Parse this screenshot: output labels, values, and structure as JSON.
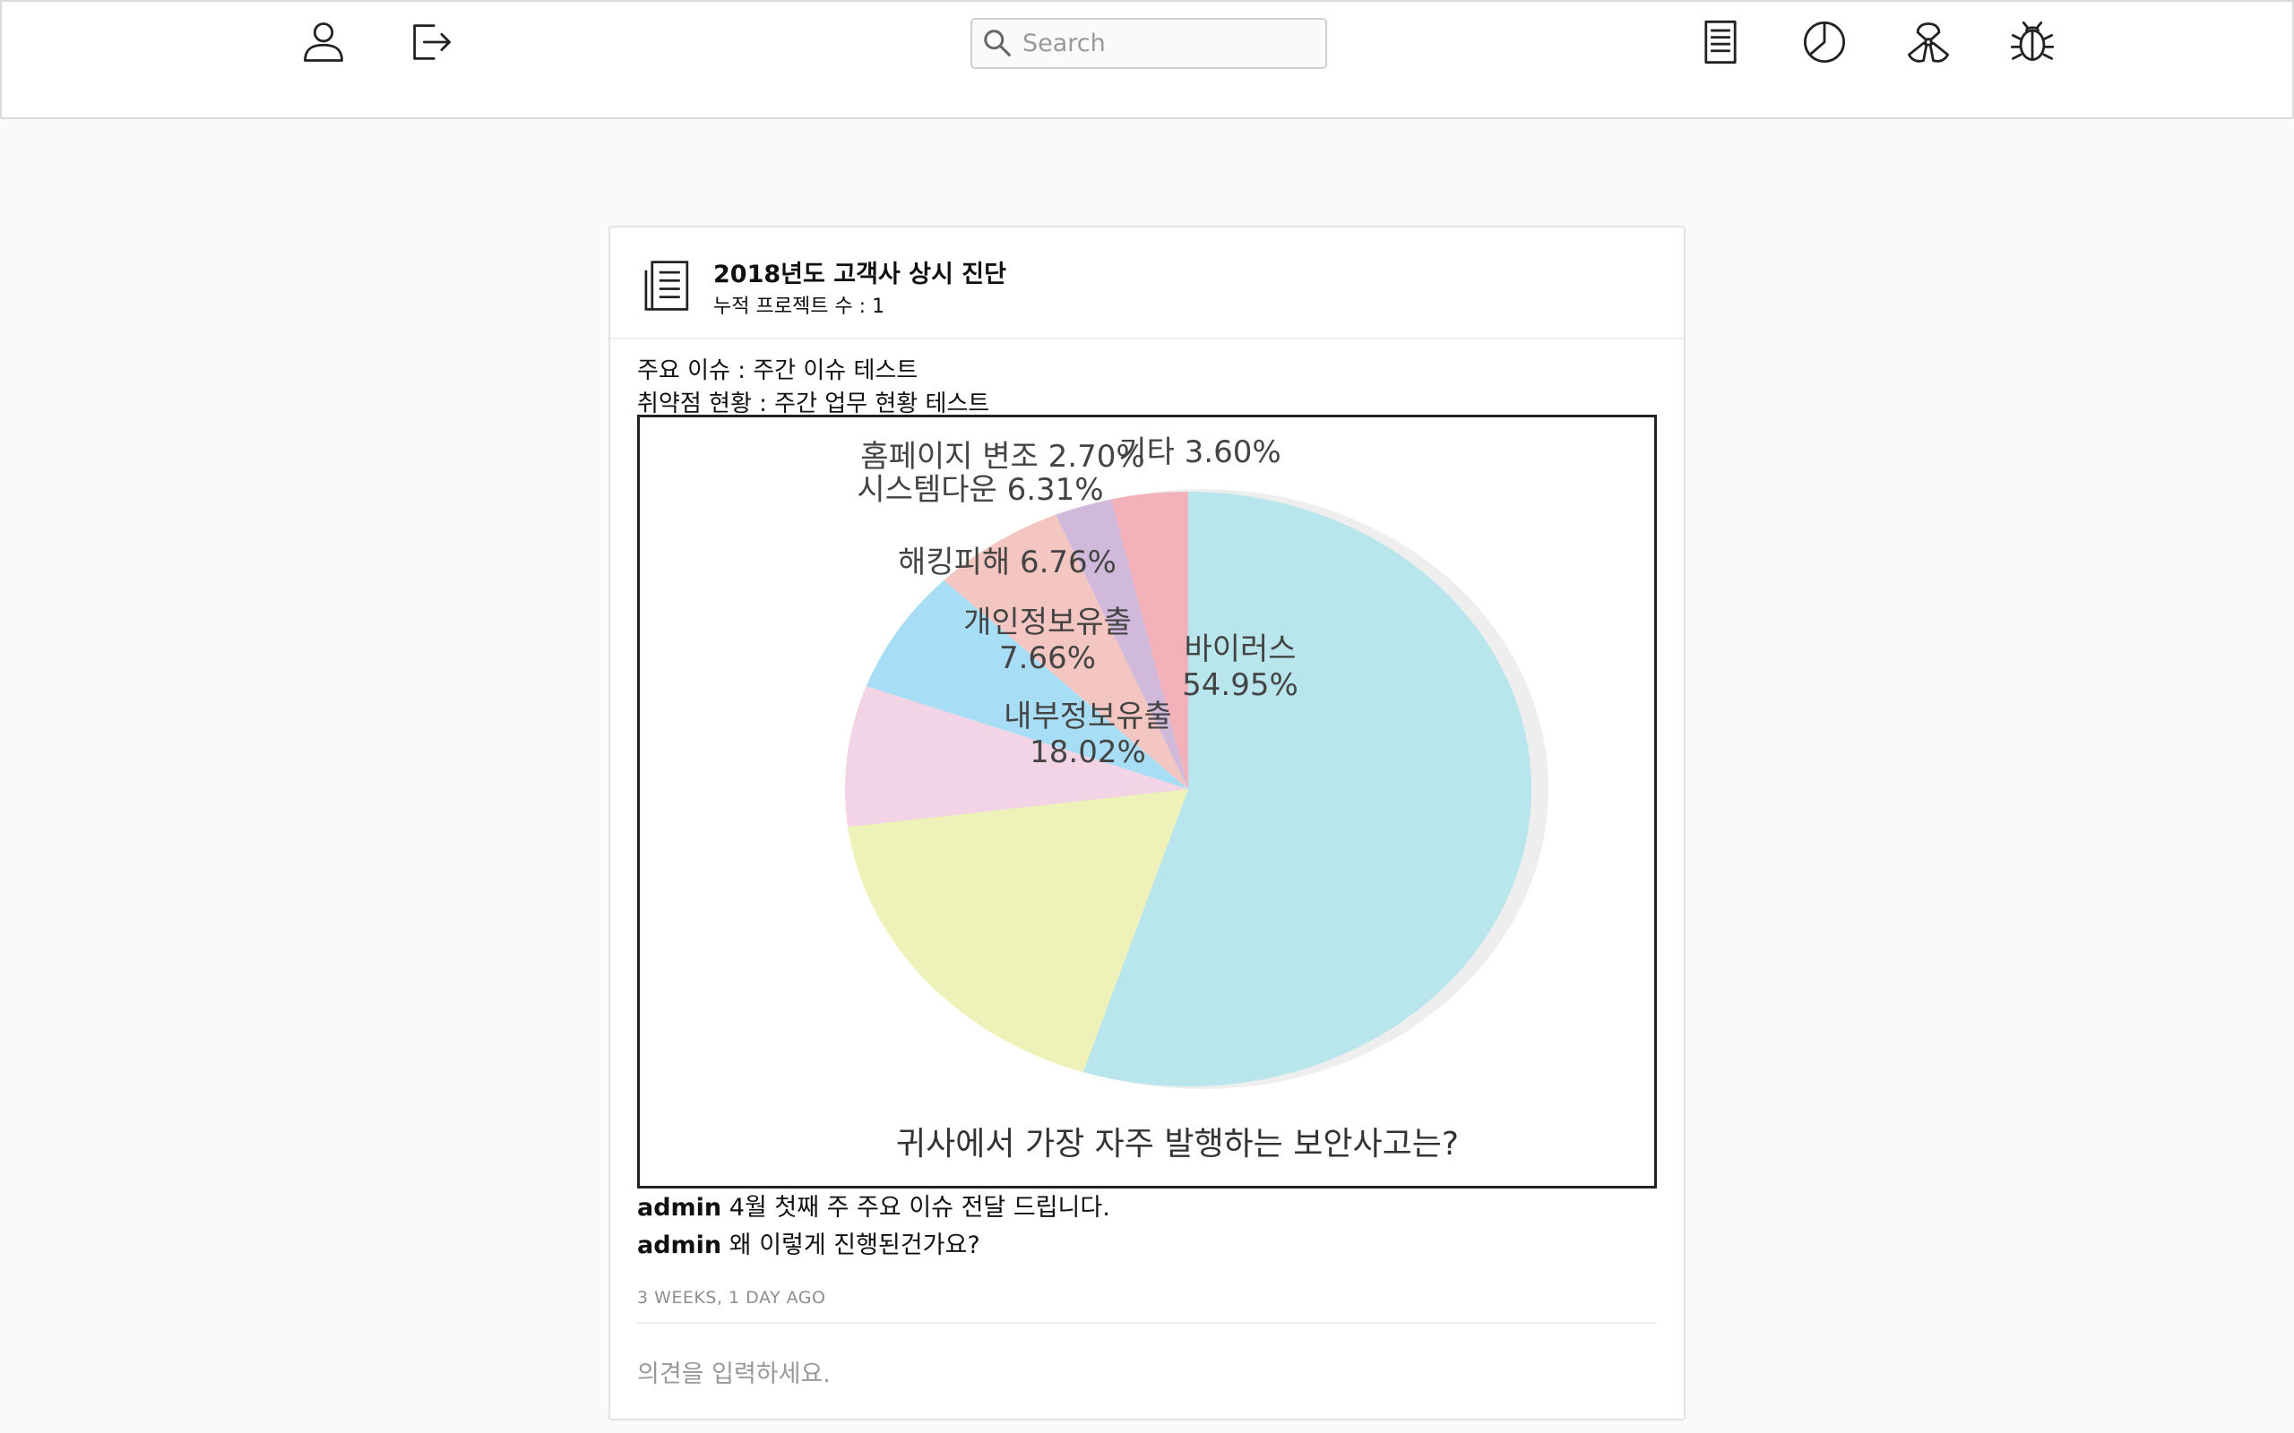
{
  "nav": {
    "search_placeholder": "Search",
    "left_icons": [
      "user-icon",
      "logout-icon"
    ],
    "right_icons": [
      "document-icon",
      "pie-chart-icon",
      "radiation-icon",
      "bug-icon"
    ]
  },
  "post": {
    "title": "2018년도 고객사 상시 진단",
    "subtitle": "누적 프로젝트 수 : 1",
    "issue_lines": [
      "주요 이슈 : 주간 이슈 테스트",
      "취약점 현황 : 주간 업무 현황 테스트"
    ],
    "comments": [
      {
        "user": "admin",
        "text": "4월 첫째 주 주요 이슈 전달 드립니다."
      },
      {
        "user": "admin",
        "text": "왜 이렇게 진행된건가요?"
      }
    ],
    "timestamp": "3 WEEKS, 1 DAY AGO",
    "comment_placeholder": "의견을 입력하세요."
  },
  "chart_data": {
    "type": "pie",
    "title": "귀사에서 가장 자주 발행하는 보안사고는?",
    "slices": [
      {
        "label": "바이러스",
        "value": 54.95,
        "value_text": "54.95%",
        "color": "#b9e5ec"
      },
      {
        "label": "내부정보유출",
        "value": 18.02,
        "value_text": "18.02%",
        "color": "#eef1b8"
      },
      {
        "label": "개인정보유출",
        "value": 7.66,
        "value_text": "7.66%",
        "color": "#f3d4e6"
      },
      {
        "label": "해킹피해",
        "value": 6.76,
        "value_text": "6.76%",
        "color": "#a8def5"
      },
      {
        "label": "시스템다운",
        "value": 6.31,
        "value_text": "6.31%",
        "color": "#f4c6c1"
      },
      {
        "label": "홈페이지 변조",
        "value": 2.7,
        "value_text": "2.70%",
        "color": "#d1b9dc"
      },
      {
        "label": "기타",
        "value": 3.6,
        "value_text": "3.60%",
        "color": "#f3b1b9"
      }
    ]
  }
}
